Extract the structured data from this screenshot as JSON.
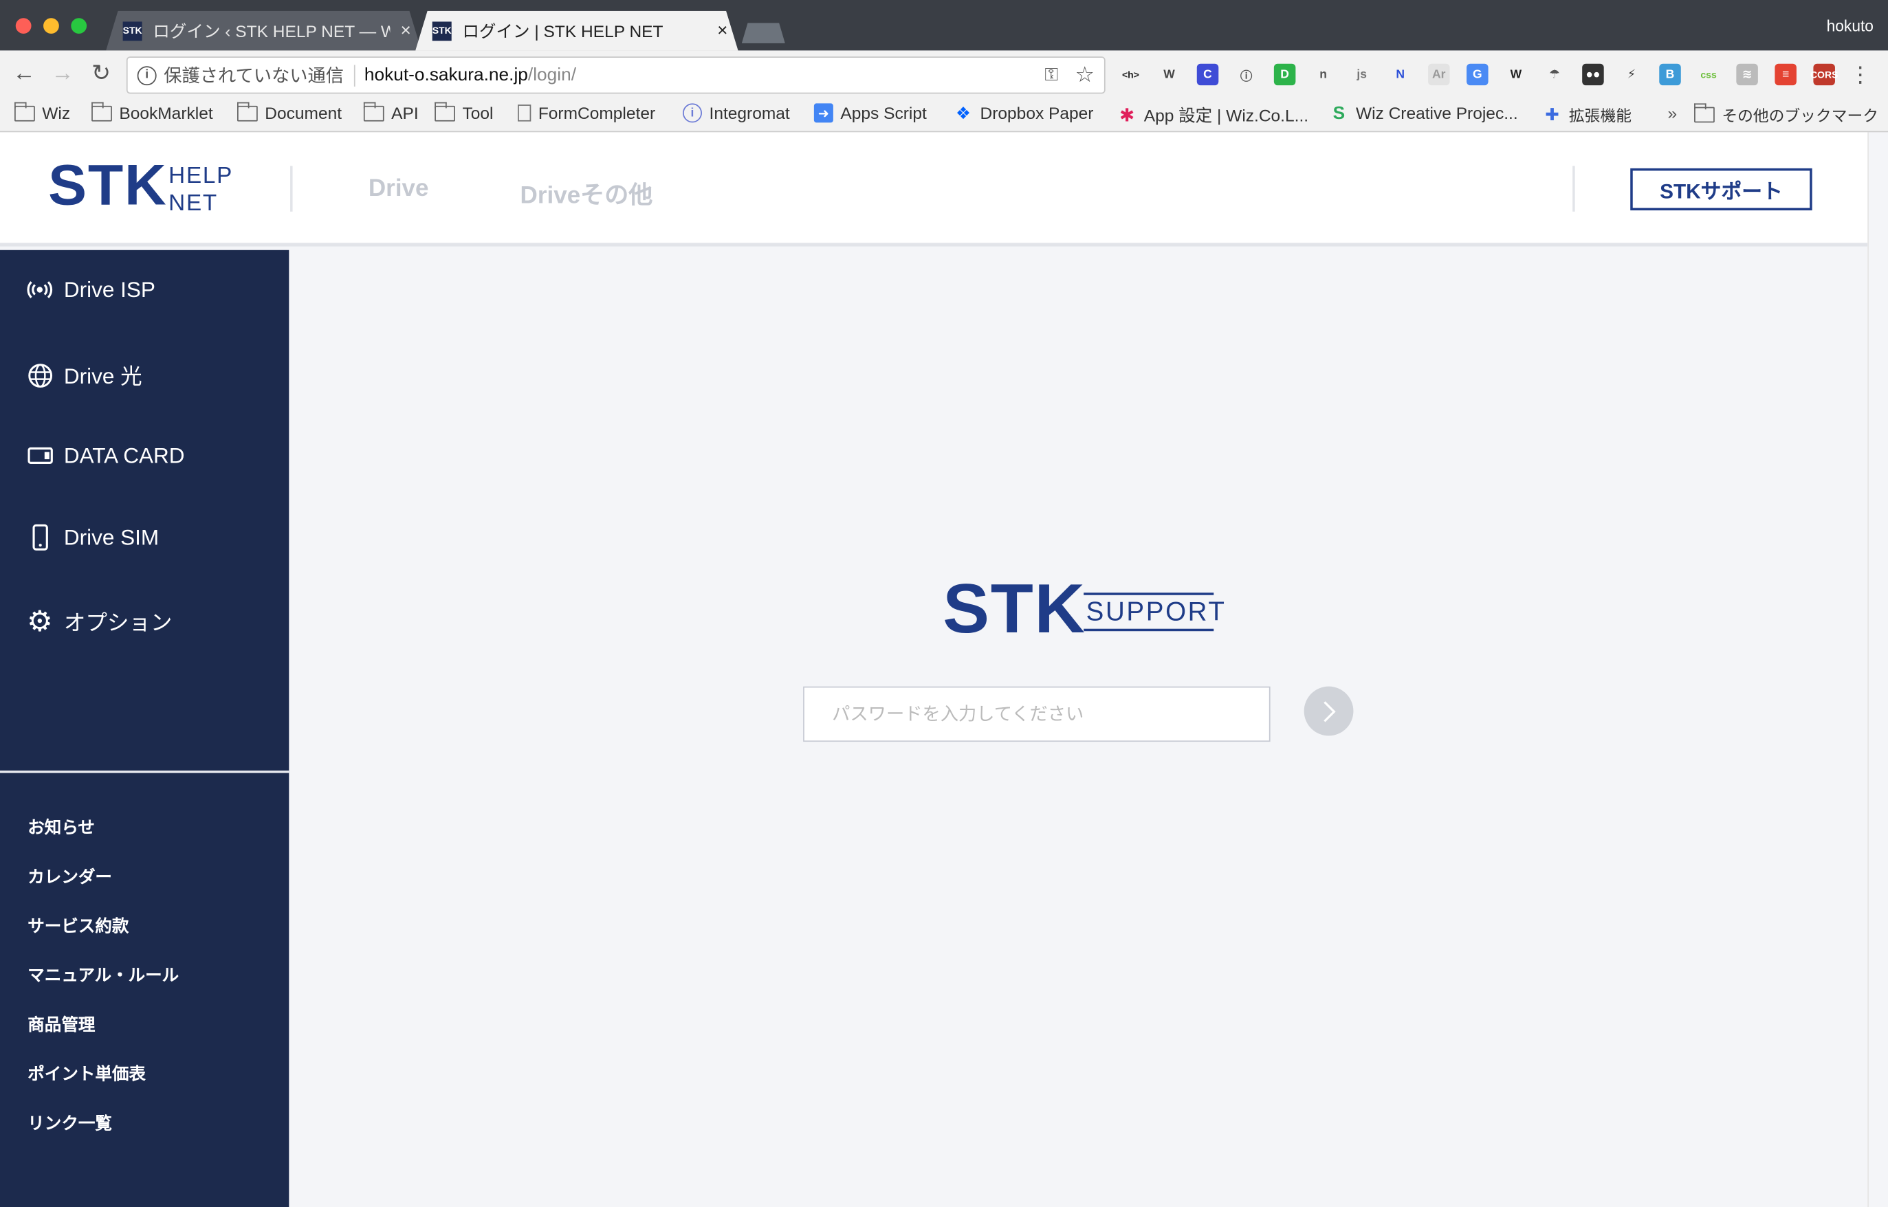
{
  "browser": {
    "tabs": [
      {
        "label": "ログイン ‹ STK HELP NET — W",
        "favicon": "STK",
        "active": false
      },
      {
        "label": "ログイン | STK HELP NET",
        "favicon": "STK",
        "active": true
      }
    ],
    "profile": "hokuto",
    "address": {
      "security": "保護されていない通信",
      "host": "hokut-o.sakura.ne.jp",
      "path": "/login/"
    },
    "extensions": [
      "<h>",
      "W",
      "C",
      "ⓘ",
      "D",
      "n",
      "js",
      "N",
      "Ar",
      "G",
      "W",
      "☂",
      "●●",
      "⚡",
      "B",
      "css",
      "≋",
      "≡",
      "CORS"
    ],
    "bookmarks": [
      {
        "label": "Wiz",
        "icon": "folder-icon"
      },
      {
        "label": "BookMarklet",
        "icon": "folder-icon"
      },
      {
        "label": "Document",
        "icon": "folder-icon"
      },
      {
        "label": "API",
        "icon": "folder-icon"
      },
      {
        "label": "Tool",
        "icon": "folder-icon"
      },
      {
        "label": "FormCompleter",
        "icon": "page-icon"
      },
      {
        "label": "Integromat",
        "icon": "integromat-icon"
      },
      {
        "label": "Apps Script",
        "icon": "apps-script-icon"
      },
      {
        "label": "Dropbox Paper",
        "icon": "dropbox-icon"
      },
      {
        "label": "App 設定 | Wiz.Co.L...",
        "icon": "slack-icon"
      },
      {
        "label": "Wiz Creative Projec...",
        "icon": "wiz-creative-icon"
      },
      {
        "label": "拡張機能",
        "icon": "puzzle-icon"
      }
    ],
    "overflow": "»",
    "other_bookmarks": "その他のブックマーク"
  },
  "header": {
    "logo_main": "STK",
    "logo_sub1": "HELP",
    "logo_sub2": "NET",
    "nav": [
      "Drive",
      "Driveその他"
    ],
    "support_button": "STKサポート"
  },
  "sidebar": {
    "items": [
      {
        "label": "Drive ISP",
        "icon": "broadcast-icon"
      },
      {
        "label": "Drive 光",
        "icon": "globe-icon"
      },
      {
        "label": "DATA CARD",
        "icon": "card-icon"
      },
      {
        "label": "Drive SIM",
        "icon": "phone-icon"
      },
      {
        "label": "オプション",
        "icon": "gear-icon"
      }
    ],
    "links": [
      "お知らせ",
      "カレンダー",
      "サービス約款",
      "マニュアル・ルール",
      "商品管理",
      "ポイント単価表",
      "リンク一覧"
    ]
  },
  "login": {
    "logo_main": "STK",
    "logo_sub": "SUPPORT",
    "password_placeholder": "パスワードを入力してください",
    "password_value": "",
    "submit_icon": "chevron-right-icon"
  },
  "colors": {
    "brand": "#1f3c88",
    "sidebar": "#1c2a4d",
    "background": "#f4f5f8"
  }
}
